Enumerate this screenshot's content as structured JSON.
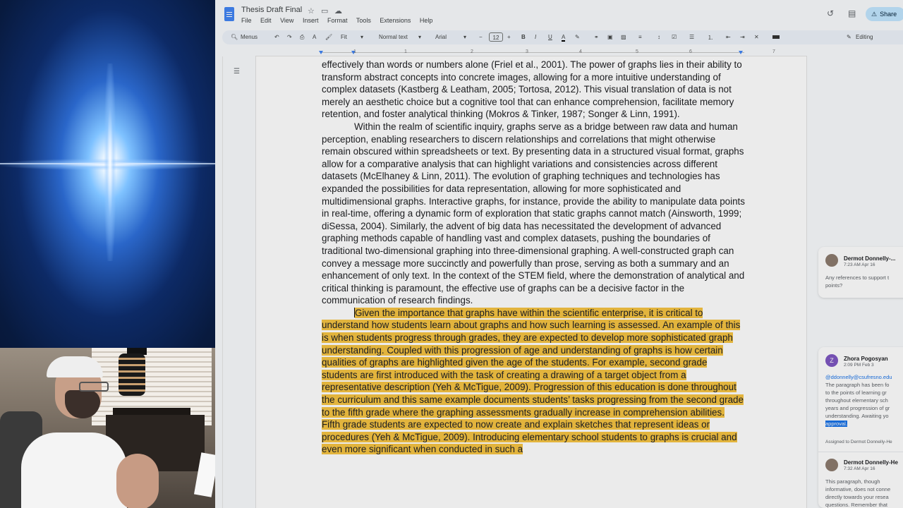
{
  "document": {
    "title": "Thesis Draft Final",
    "menu": [
      "File",
      "Edit",
      "View",
      "Insert",
      "Format",
      "Tools",
      "Extensions",
      "Help"
    ],
    "share_label": "Share",
    "editing_label": "Editing"
  },
  "toolbar": {
    "menus_label": "Menus",
    "zoom": "Fit",
    "style": "Normal text",
    "font": "Arial",
    "font_size": "12"
  },
  "ruler": {
    "marks": [
      "1",
      "1",
      "2",
      "3",
      "4",
      "5",
      "6",
      "7"
    ]
  },
  "body": {
    "para1": "effectively than words or numbers alone (Friel et al., 2001). The power of graphs lies in their ability to transform abstract concepts into concrete images, allowing for a more intuitive understanding of complex datasets (Kastberg & Leatham, 2005; Tortosa, 2012). This visual translation of data is not merely an aesthetic choice but a cognitive tool that can enhance comprehension, facilitate memory retention, and foster analytical thinking (Mokros & Tinker, 1987; Songer & Linn, 1991).",
    "para2": "Within the realm of scientific inquiry, graphs serve as a bridge between raw data and human perception, enabling researchers to discern relationships and correlations that might otherwise remain obscured within spreadsheets or text. By presenting data in a structured visual format, graphs allow for a comparative analysis that can highlight variations and consistencies across different datasets (McElhaney & Linn, 2011). The evolution of graphing techniques and technologies has expanded the possibilities for data representation, allowing for more sophisticated and multidimensional graphs. Interactive graphs, for instance, provide the ability to manipulate data points in real-time, offering a dynamic form of exploration that static graphs cannot match (Ainsworth, 1999; diSessa, 2004). Similarly, the advent of big data has necessitated the development of advanced graphing methods capable of handling vast and complex datasets, pushing the boundaries of traditional two-dimensional graphing into three-dimensional graphing. A well-constructed graph can convey a message more succinctly and powerfully than prose, serving as both a summary and an enhancement of only text. In the context of the STEM field, where the demonstration of analytical and critical thinking is paramount, the effective use of graphs can be a decisive factor in the communication of research findings.",
    "para3": "Given the importance that graphs have within the scientific enterprise, it is critical to understand how students learn about graphs and how such learning is assessed. An example of this is when students progress through grades, they are expected to develop more sophisticated graph understanding. Coupled with this progression of age and understanding of graphs is how certain qualities of graphs are highlighted given the age of the students. For example, second grade students are first introduced with the task of  creating a drawing of a target object from a representative description (Yeh & McTigue, 2009). Progression of this education is done throughout the curriculum and this same example documents students’ tasks progressing from the second grade to the fifth grade where the graphing assessments gradually increase in comprehension abilities. Fifth grade students are expected to now create and explain sketches that represent ideas or procedures (Yeh & McTigue, 2009). Introducing elementary school students to graphs is crucial and even more significant when conducted in such a"
  },
  "comments": {
    "c1": {
      "author": "Dermot Donnelly-...",
      "time": "7:23 AM Apr 16",
      "line1": "Any references to support t",
      "line2": "points?"
    },
    "c2": {
      "initial": "Z",
      "author": "Zhora Pogosyan",
      "time": "2:09 PM Feb 3",
      "mention": "@ddonnelly@csufresno.edu",
      "line1": "The paragraph has been fo",
      "line2": "to the points of learning gr",
      "line3": "throughout elementary sch",
      "line4": "years and progression of gr",
      "line5": "understanding. Awaiting yo",
      "line6": "approval.",
      "assigned": "Assigned to Dermot Donnelly-He"
    },
    "c3": {
      "author": "Dermot Donnelly-He",
      "time": "7:32 AM Apr 16",
      "line1": "This paragraph, though",
      "line2": "informative, does not conne",
      "line3": "directly towards your resea",
      "line4": "questions. Remember that"
    }
  },
  "colors": {
    "highlight": "#f6c443",
    "share_bg": "#c2e7ff",
    "avatar_z": "#7e57c2"
  }
}
